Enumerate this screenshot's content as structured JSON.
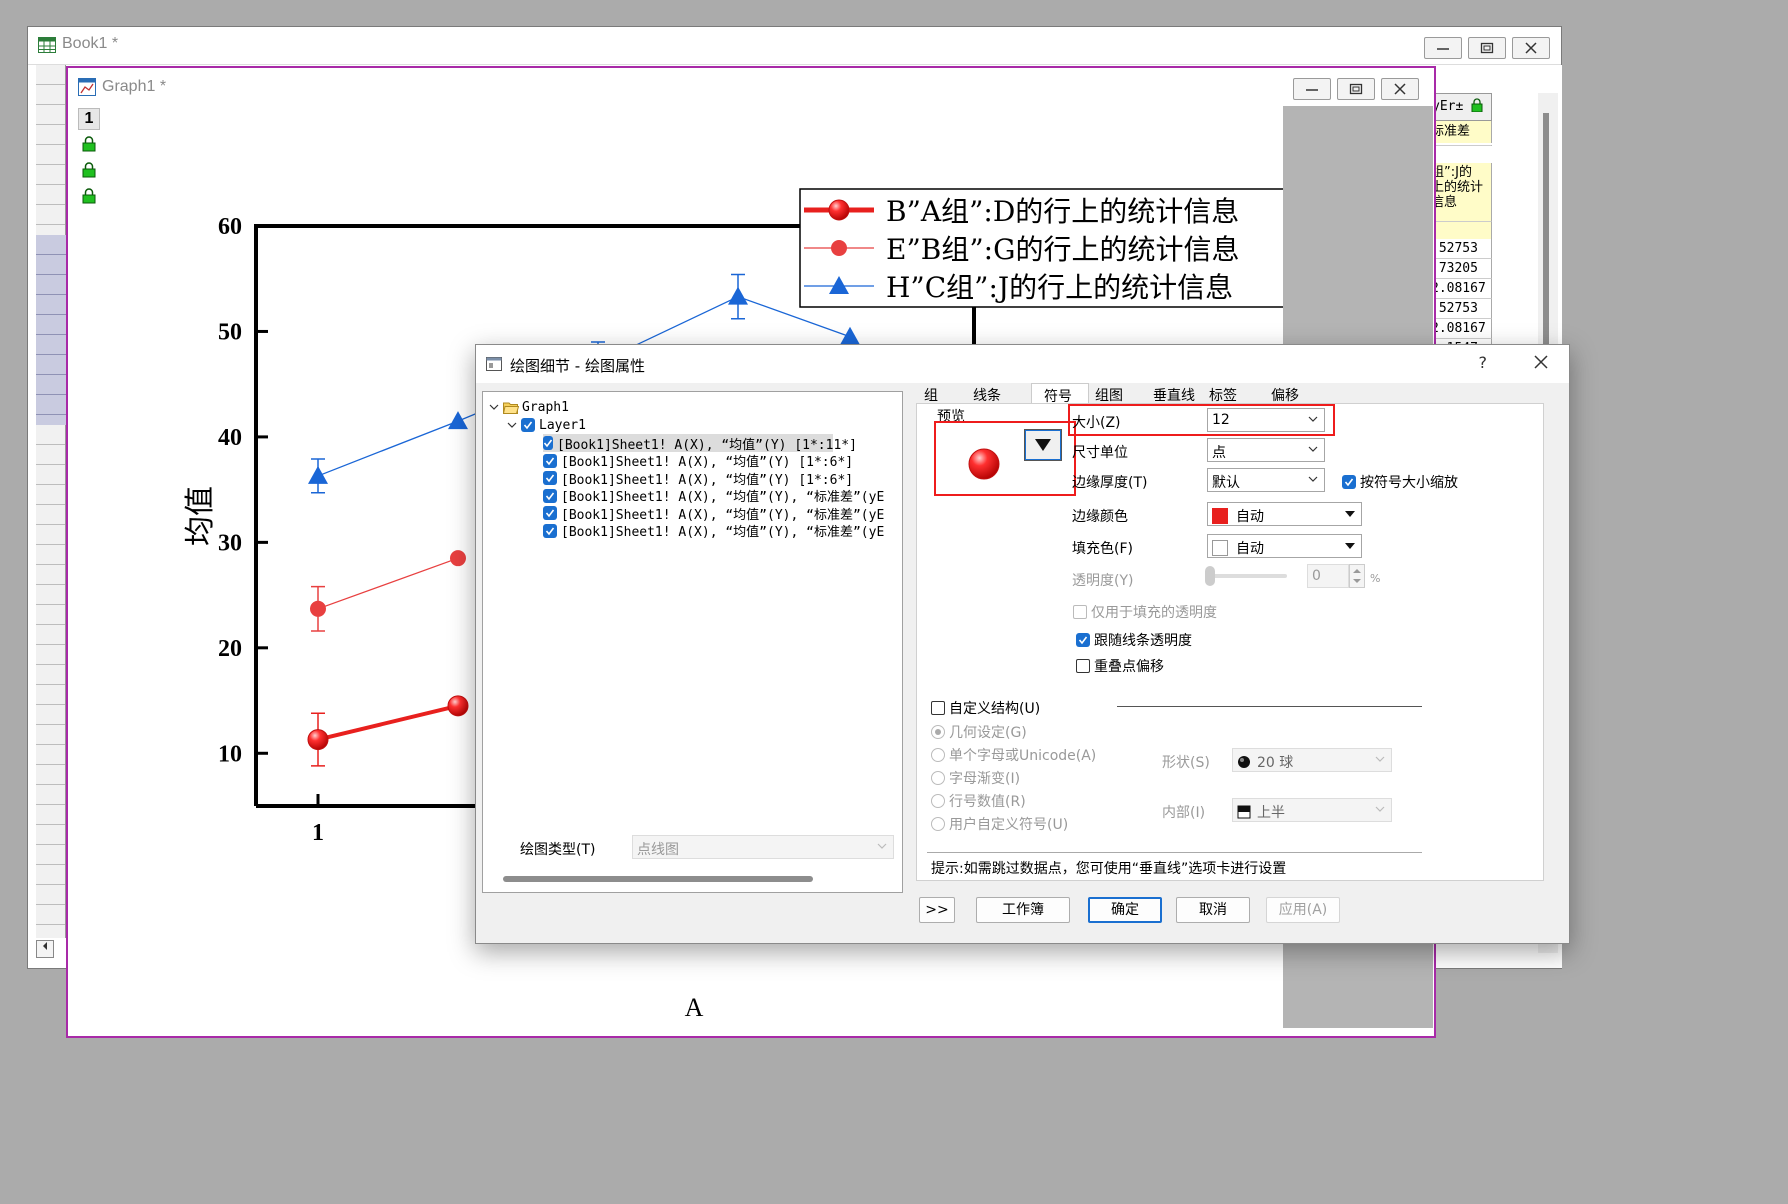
{
  "book_window": {
    "title": "Book1 *",
    "sheet": {
      "col_header": "yEr±",
      "long_name": "标准差",
      "comment_lines": [
        "组”:J的",
        "上的统计",
        "信息"
      ],
      "values": [
        ".52753",
        ".73205",
        "2.08167",
        ".52753",
        "2.08167",
        "1.1547"
      ]
    }
  },
  "graph_window": {
    "title": "Graph1 *",
    "layer_number": "1"
  },
  "chart_data": {
    "type": "line",
    "ylabel": "均值",
    "xlabel": "A",
    "ylim": [
      5,
      60
    ],
    "y_ticks": [
      "10",
      "20",
      "30",
      "40",
      "50",
      "60"
    ],
    "x_ticks": [
      "1"
    ],
    "series": [
      {
        "name": "B”A组”:D的行上的统计信息",
        "color": "#e8201e",
        "marker": "ball",
        "x": [
          1,
          2
        ],
        "y": [
          11.3,
          14.5
        ],
        "err": [
          2.5,
          0
        ]
      },
      {
        "name": "E”B组”:G的行上的统计信息",
        "color": "#e84040",
        "marker": "circle",
        "x": [
          1,
          2
        ],
        "y": [
          23.7,
          28.5
        ],
        "err": [
          2.1,
          0
        ]
      },
      {
        "name": "H”C组”:J的行上的统计信息",
        "color": "#1a66d6",
        "marker": "triangle",
        "x": [
          1,
          2,
          3,
          4,
          4.8
        ],
        "y": [
          36.3,
          41.5,
          47.0,
          53.3,
          49.5
        ],
        "err": [
          1.6,
          0,
          2.0,
          2.1,
          0
        ]
      }
    ],
    "legend_position": "top-right"
  },
  "dialog": {
    "title": "绘图细节 - 绘图属性",
    "help": "?",
    "tree": {
      "root": "Graph1",
      "layer": "Layer1",
      "items": [
        "[Book1]Sheet1! A(X), “均值”(Y) [1*:11*]",
        "[Book1]Sheet1! A(X), “均值”(Y) [1*:6*]",
        "[Book1]Sheet1! A(X), “均值”(Y) [1*:6*]",
        "[Book1]Sheet1! A(X), “均值”(Y), “标准差”(yE",
        "[Book1]Sheet1! A(X), “均值”(Y), “标准差”(yE",
        "[Book1]Sheet1! A(X), “均值”(Y), “标准差”(yE"
      ]
    },
    "tabs": [
      "组",
      "线条",
      "符号",
      "组图",
      "垂直线",
      "标签",
      "偏移"
    ],
    "active_tab": "符号",
    "symbol": {
      "preview_label": "预览",
      "size_label": "大小(Z)",
      "size_value": "12",
      "unit_label": "尺寸单位",
      "unit_value": "点",
      "edge_thickness_label": "边缘厚度(T)",
      "edge_thickness_value": "默认",
      "scale_check_label": "按符号大小缩放",
      "edge_color_label": "边缘颜色",
      "edge_color_value": "自动",
      "edge_color_hex": "#e8201e",
      "fill_color_label": "填充色(F)",
      "fill_color_value": "自动",
      "transparency_label": "透明度(Y)",
      "transparency_value": "0",
      "transparency_unit": "%",
      "fill_only_label": "仅用于填充的透明度",
      "follow_line_label": "跟随线条透明度",
      "overlap_label": "重叠点偏移",
      "custom_struct_label": "自定义结构(U)",
      "radio_geometry": "几何设定(G)",
      "radio_unicode": "单个字母或Unicode(A)",
      "radio_gradient": "字母渐变(I)",
      "radio_rownum": "行号数值(R)",
      "radio_user": "用户自定义符号(U)",
      "shape_label": "形状(S)",
      "shape_value": "20 球",
      "interior_label": "内部(I)",
      "interior_value": "上半",
      "hint": "提示:如需跳过数据点，您可使用“垂直线”选项卡进行设置"
    },
    "plot_type_label": "绘图类型(T)",
    "plot_type_value": "点线图",
    "buttons": {
      "expand": ">>",
      "workbook": "工作簿",
      "ok": "确定",
      "cancel": "取消",
      "apply": "应用(A)"
    }
  }
}
